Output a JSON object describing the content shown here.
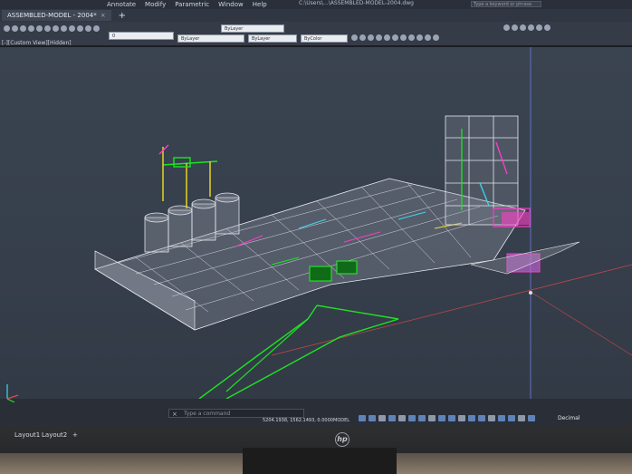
{
  "app": {
    "menu": [
      "Annotate",
      "Modify",
      "Parametric",
      "Window",
      "Help"
    ],
    "file_path": "C:\\Users\\...\\ASSEMBLED-MODEL-2004.dwg",
    "search_placeholder": "Type a keyword or phrase"
  },
  "document_tab": {
    "title": "ASSEMBLED-MODEL - 2004*",
    "close": "×",
    "new_tab": "+"
  },
  "properties": {
    "layer_value": "0",
    "color_value": "ByLayer",
    "linetype_value": "ByLayer",
    "lineweight_value": "ByLayer",
    "plot_style": "ByColor"
  },
  "viewport": {
    "label": "[-][Custom View][Hidden]"
  },
  "command_line": {
    "placeholder": "Type a command",
    "close": "×"
  },
  "statusbar": {
    "coordinates": "5204.1938, 1562.1493, 0.0000",
    "model_label": "MODEL",
    "units": "Decimal"
  },
  "layout_tabs": [
    "Layout1",
    "Layout2"
  ],
  "layout_add": "+",
  "monitor": {
    "brand": "hp"
  },
  "colors": {
    "viewport_bg": "#37404d",
    "model_lines": "#d8dde6",
    "accent_green": "#19e61e",
    "accent_magenta": "#ff3cc8",
    "accent_yellow": "#f0e020",
    "status_icon_blue": "#5f83b8"
  }
}
